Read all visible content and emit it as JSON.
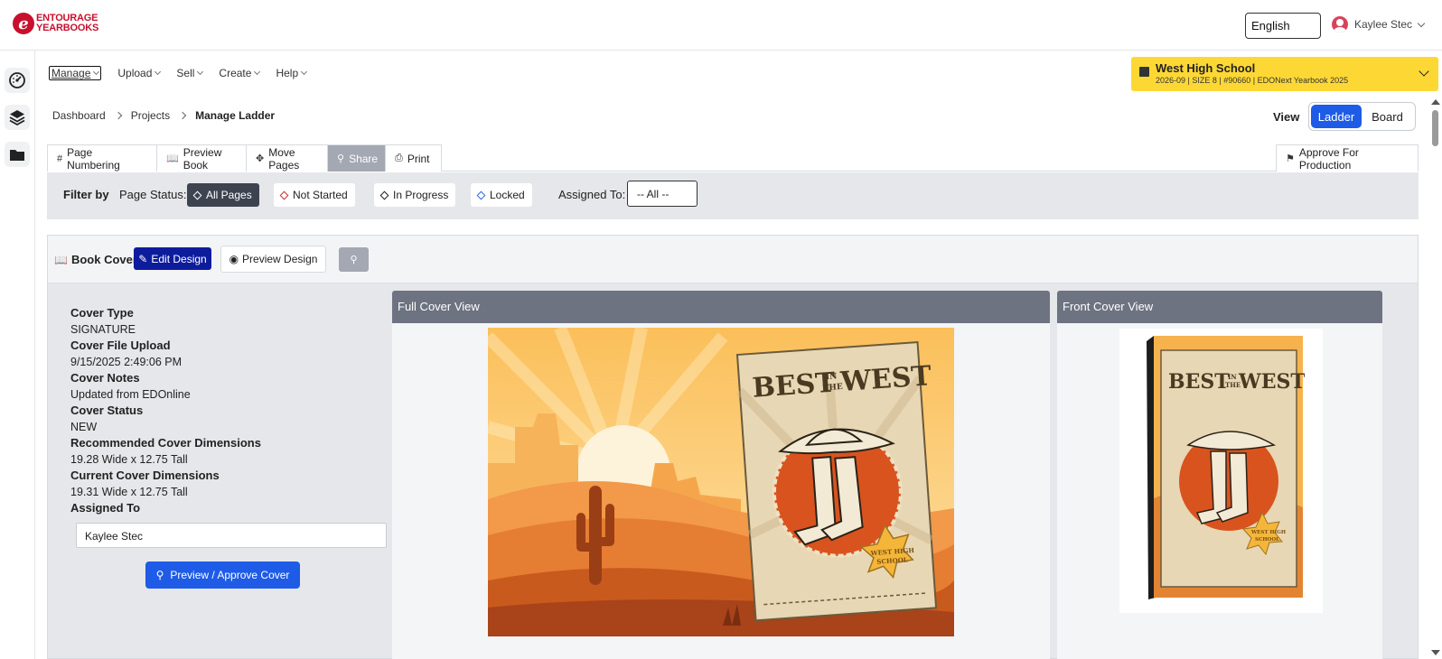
{
  "header": {
    "logo_line1": "ENTOURAGE",
    "logo_line2": "YEARBOOKS",
    "language": "English",
    "user_name": "Kaylee Stec"
  },
  "menu": {
    "items": [
      {
        "label": "Manage"
      },
      {
        "label": "Upload"
      },
      {
        "label": "Sell"
      },
      {
        "label": "Create"
      },
      {
        "label": "Help"
      }
    ]
  },
  "school": {
    "name": "West High School",
    "details": "2026-09 | SIZE 8 | #90660 | EDONext Yearbook 2025",
    "color": "#fdd835"
  },
  "breadcrumb": {
    "items": [
      "Dashboard",
      "Projects"
    ],
    "current": "Manage Ladder"
  },
  "view": {
    "label": "View",
    "options": [
      "Ladder",
      "Board"
    ],
    "selected": "Ladder"
  },
  "toolbar": {
    "page_numbering": "Page Numbering",
    "preview_book": "Preview Book",
    "move_pages": "Move Pages",
    "share": "Share",
    "print": "Print",
    "approve_production": "Approve For Production"
  },
  "filter": {
    "label": "Filter by",
    "page_status_label": "Page Status:",
    "statuses": [
      "All Pages",
      "Not Started",
      "In Progress",
      "Locked"
    ],
    "selected_status": "All Pages",
    "assigned_label": "Assigned To:",
    "assigned_value": "-- All --"
  },
  "book_cover": {
    "title": "Book Cover",
    "edit_design": "Edit Design",
    "preview_design": "Preview Design",
    "fields": [
      {
        "label": "Cover Type",
        "value": "SIGNATURE"
      },
      {
        "label": "Cover File Upload",
        "value": "9/15/2025 2:49:06 PM"
      },
      {
        "label": "Cover Notes",
        "value": "Updated from EDOnline"
      },
      {
        "label": "Cover Status",
        "value": "NEW"
      },
      {
        "label": "Recommended Cover Dimensions",
        "value": "19.28 Wide x 12.75 Tall"
      },
      {
        "label": "Current Cover Dimensions",
        "value": "19.31 Wide x 12.75 Tall"
      }
    ],
    "assigned_to_label": "Assigned To",
    "assigned_to_value": "Kaylee Stec",
    "approve_button": "Preview / Approve Cover"
  },
  "panels": {
    "full_cover": "Full Cover View",
    "front_cover": "Front Cover View"
  },
  "cover_art": {
    "headline_1": "BEST",
    "headline_small_1": "IN",
    "headline_small_2": "THE",
    "headline_2": "WEST",
    "badge_line1": "WEST HIGH",
    "badge_line2": "SCHOOL"
  },
  "colors": {
    "accent_blue": "#1e5be6",
    "edit_navy": "#0d1c9c",
    "brand_red": "#c8102e"
  }
}
